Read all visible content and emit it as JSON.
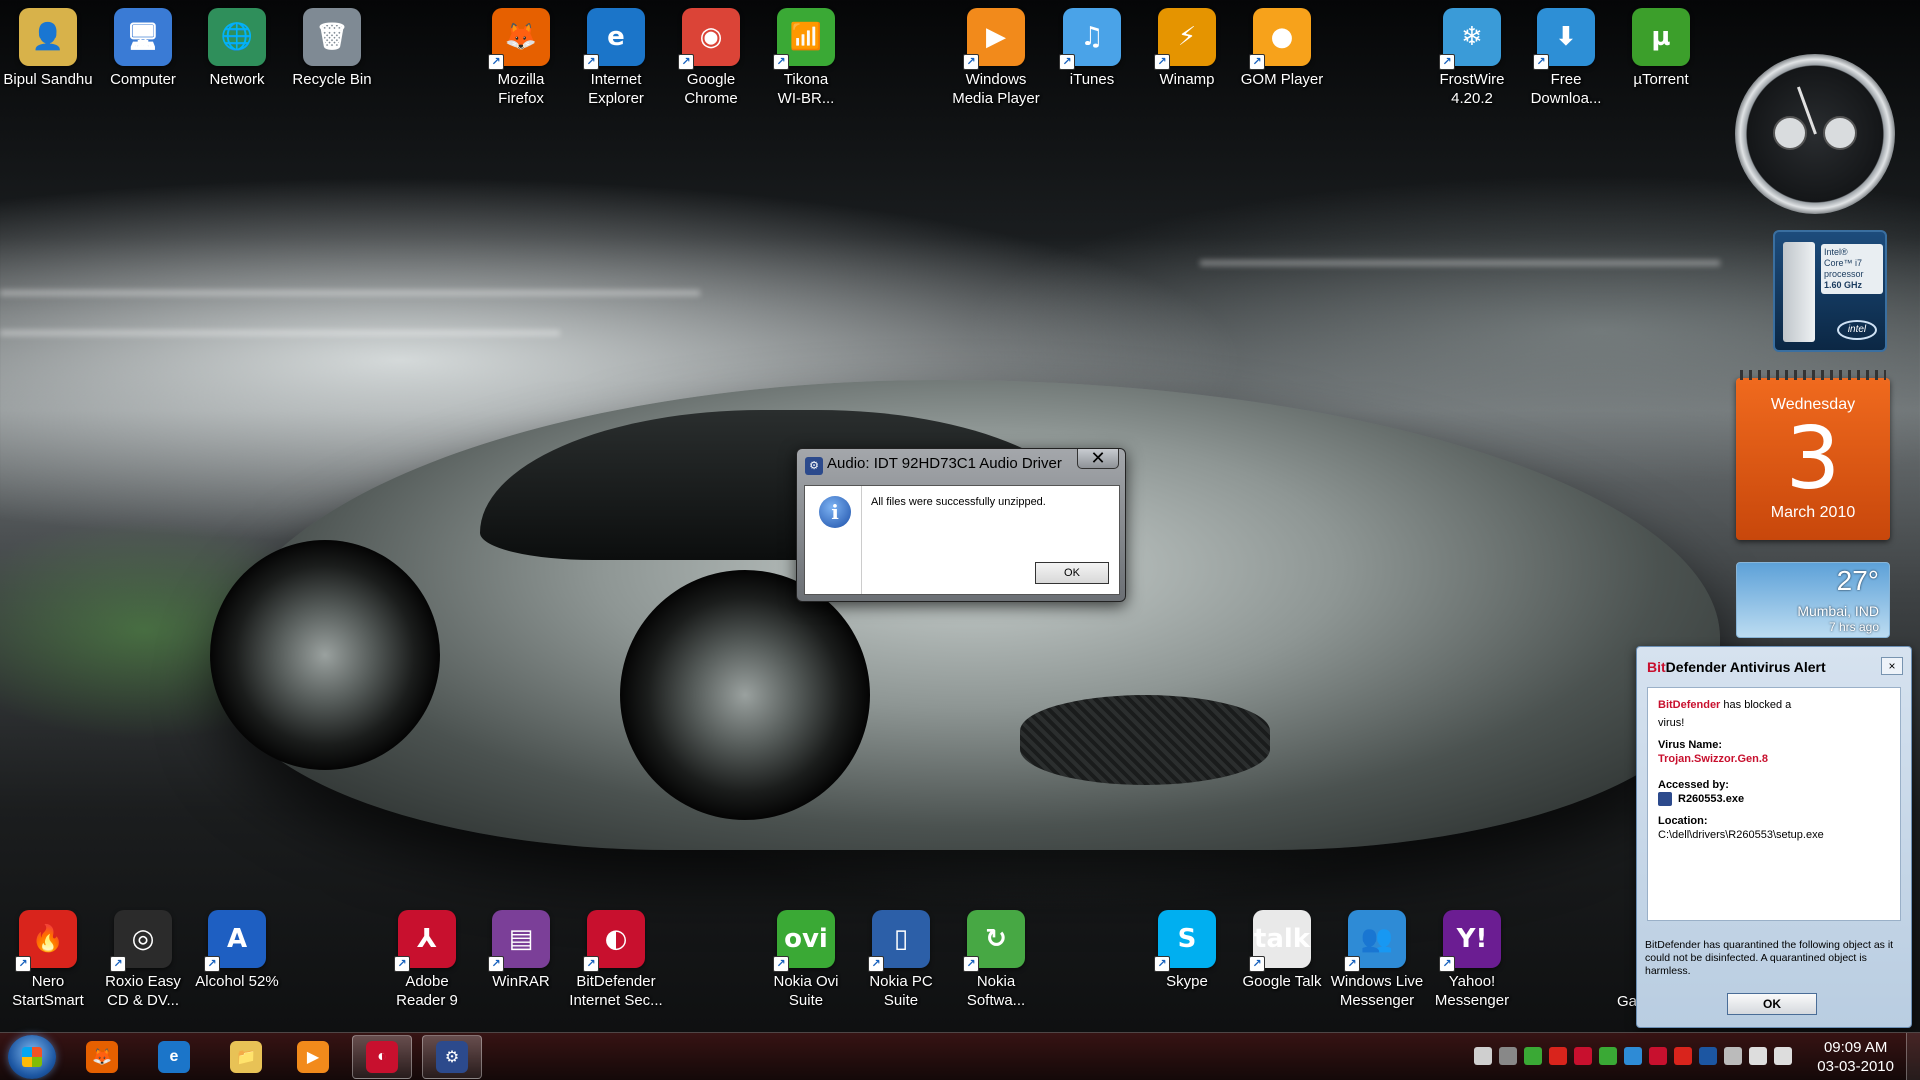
{
  "desktop_icons_top": [
    {
      "id": "bipul-sandhu",
      "label": "Bipul Sandhu",
      "icon": "user-folder-icon",
      "color": "#d8b24a",
      "glyph": "👤",
      "shortcut": false
    },
    {
      "id": "computer",
      "label": "Computer",
      "icon": "computer-icon",
      "color": "#3a7bd5",
      "glyph": "🖥",
      "shortcut": false
    },
    {
      "id": "network",
      "label": "Network",
      "icon": "network-globe-icon",
      "color": "#2f8f5b",
      "glyph": "🌐",
      "shortcut": false
    },
    {
      "id": "recycle-bin",
      "label": "Recycle Bin",
      "icon": "recycle-bin-icon",
      "color": "#7f8a94",
      "glyph": "🗑",
      "shortcut": false
    },
    {
      "id": "firefox",
      "label": "Mozilla\nFirefox",
      "icon": "firefox-icon",
      "color": "#e66000",
      "glyph": "🦊",
      "shortcut": true
    },
    {
      "id": "ie",
      "label": "Internet\nExplorer",
      "icon": "internet-explorer-icon",
      "color": "#1b75c9",
      "glyph": "e",
      "shortcut": true
    },
    {
      "id": "chrome",
      "label": "Google\nChrome",
      "icon": "chrome-icon",
      "color": "#db4437",
      "glyph": "◉",
      "shortcut": true
    },
    {
      "id": "tikona",
      "label": "Tikona\nWI-BR...",
      "icon": "wifi-icon",
      "color": "#3aa935",
      "glyph": "📶",
      "shortcut": true
    },
    {
      "id": "wmp",
      "label": "Windows\nMedia Player",
      "icon": "media-player-icon",
      "color": "#f28a1b",
      "glyph": "▶",
      "shortcut": true
    },
    {
      "id": "itunes",
      "label": "iTunes",
      "icon": "itunes-icon",
      "color": "#4aa3e8",
      "glyph": "♫",
      "shortcut": true
    },
    {
      "id": "winamp",
      "label": "Winamp",
      "icon": "winamp-icon",
      "color": "#e59400",
      "glyph": "⚡",
      "shortcut": true
    },
    {
      "id": "gom",
      "label": "GOM Player",
      "icon": "gom-player-icon",
      "color": "#f7a21b",
      "glyph": "●",
      "shortcut": true
    },
    {
      "id": "frostwire",
      "label": "FrostWire\n4.20.2",
      "icon": "frostwire-icon",
      "color": "#3a9bd8",
      "glyph": "❄",
      "shortcut": true
    },
    {
      "id": "free-download",
      "label": "Free\nDownloa...",
      "icon": "download-icon",
      "color": "#2d8fd6",
      "glyph": "⬇",
      "shortcut": true
    },
    {
      "id": "utorrent",
      "label": "µTorrent",
      "icon": "utorrent-icon",
      "color": "#3c9f2b",
      "glyph": "µ",
      "shortcut": false
    }
  ],
  "desktop_icons_bottom": [
    {
      "id": "nero",
      "label": "Nero\nStartSmart",
      "icon": "nero-icon",
      "color": "#d9241c",
      "glyph": "🔥",
      "shortcut": true
    },
    {
      "id": "roxio",
      "label": "Roxio Easy\nCD & DV...",
      "icon": "roxio-disc-icon",
      "color": "#2b2b2b",
      "glyph": "◎",
      "shortcut": true
    },
    {
      "id": "alcohol",
      "label": "Alcohol 52%",
      "icon": "alcohol-icon",
      "color": "#1e5fc2",
      "glyph": "A",
      "shortcut": true
    },
    {
      "id": "adobe",
      "label": "Adobe\nReader 9",
      "icon": "adobe-reader-icon",
      "color": "#c8102e",
      "glyph": "⅄",
      "shortcut": true
    },
    {
      "id": "winrar",
      "label": "WinRAR",
      "icon": "winrar-icon",
      "color": "#7b3f98",
      "glyph": "▤",
      "shortcut": true
    },
    {
      "id": "bitdefender",
      "label": "BitDefender\nInternet Sec...",
      "icon": "bitdefender-icon",
      "color": "#c8102e",
      "glyph": "◐",
      "shortcut": true
    },
    {
      "id": "ovi",
      "label": "Nokia Ovi\nSuite",
      "icon": "nokia-ovi-icon",
      "color": "#3aa935",
      "glyph": "ovi",
      "shortcut": true
    },
    {
      "id": "nokia-pc",
      "label": "Nokia PC\nSuite",
      "icon": "nokia-pc-suite-icon",
      "color": "#2c5fa8",
      "glyph": "▯",
      "shortcut": true
    },
    {
      "id": "nokia-sw",
      "label": "Nokia\nSoftwa...",
      "icon": "nokia-software-icon",
      "color": "#47a844",
      "glyph": "↻",
      "shortcut": true
    },
    {
      "id": "skype",
      "label": "Skype",
      "icon": "skype-icon",
      "color": "#00aff0",
      "glyph": "S",
      "shortcut": true
    },
    {
      "id": "gtalk",
      "label": "Google Talk",
      "icon": "google-talk-icon",
      "color": "#e9e9e9",
      "glyph": "talk",
      "shortcut": true
    },
    {
      "id": "wlm",
      "label": "Windows Live\nMessenger",
      "icon": "live-messenger-icon",
      "color": "#2e8bd6",
      "glyph": "👥",
      "shortcut": true
    },
    {
      "id": "yahoo",
      "label": "Yahoo!\nMessenger",
      "icon": "yahoo-messenger-icon",
      "color": "#6b1d92",
      "glyph": "Y!",
      "shortcut": true
    }
  ],
  "partial_label": "Ga",
  "gadgets": {
    "intel": {
      "line1": "Intel®",
      "line2": "Core™ i7",
      "line3": "processor",
      "line4": "1.60 GHz",
      "logo": "intel"
    },
    "calendar": {
      "weekday": "Wednesday",
      "day": "3",
      "month_year": "March 2010"
    },
    "weather": {
      "temp": "27°",
      "city": "Mumbai, IND",
      "updated": "7 hrs ago"
    }
  },
  "dialog": {
    "title": "Audio: IDT 92HD73C1 Audio Driver",
    "close": "✕",
    "message": "All files were successfully unzipped.",
    "ok": "OK"
  },
  "bitdefender_alert": {
    "title_brand": "Bit",
    "title_rest": "Defender Antivirus Alert",
    "close": "×",
    "brand": "BitDefender",
    "blocked_text": "has blocked a",
    "blocked_text2": "virus!",
    "virus_label": "Virus Name:",
    "virus_name": "Trojan.Swizzor.Gen.8",
    "accessed_label": "Accessed by:",
    "accessed_by": "R260553.exe",
    "location_label": "Location:",
    "location": "C:\\dell\\drivers\\R260553\\setup.exe",
    "note": "BitDefender has quarantined the following object as it could not be disinfected. A quarantined object is harmless.",
    "ok": "OK"
  },
  "taskbar": {
    "pinned": [
      {
        "id": "firefox",
        "icon": "firefox-icon",
        "color": "#e66000",
        "glyph": "🦊",
        "active": false
      },
      {
        "id": "ie",
        "icon": "internet-explorer-icon",
        "color": "#1b75c9",
        "glyph": "e",
        "active": false
      },
      {
        "id": "explorer",
        "icon": "folder-icon",
        "color": "#e8c256",
        "glyph": "📁",
        "active": false
      },
      {
        "id": "wmp",
        "icon": "media-player-icon",
        "color": "#f28a1b",
        "glyph": "▶",
        "active": false
      },
      {
        "id": "bitdefender",
        "icon": "bitdefender-icon",
        "color": "#c8102e",
        "glyph": "◐",
        "active": true
      },
      {
        "id": "installer",
        "icon": "installer-icon",
        "color": "#2c4a8c",
        "glyph": "⚙",
        "active": true
      }
    ],
    "tray": [
      {
        "icon": "tray-app-icon",
        "color": "#cfcfcf"
      },
      {
        "icon": "tray-monitor-icon",
        "color": "#888"
      },
      {
        "icon": "tray-green-icon",
        "color": "#3aa935"
      },
      {
        "icon": "tray-red-icon",
        "color": "#d9241c"
      },
      {
        "icon": "tray-bitdefender-icon",
        "color": "#c8102e"
      },
      {
        "icon": "tray-ovi-icon",
        "color": "#3aa935"
      },
      {
        "icon": "tray-network-icon",
        "color": "#2e8bd6"
      },
      {
        "icon": "tray-alert-icon",
        "color": "#c8102e"
      },
      {
        "icon": "tray-flag-icon",
        "color": "#d9241c"
      },
      {
        "icon": "bluetooth-icon",
        "color": "#1c56a2"
      },
      {
        "icon": "tray-arrow-icon",
        "color": "#bbb"
      },
      {
        "icon": "battery-icon",
        "color": "#ddd"
      },
      {
        "icon": "volume-icon",
        "color": "#ddd"
      }
    ],
    "time": "09:09 AM",
    "date": "03-03-2010"
  }
}
